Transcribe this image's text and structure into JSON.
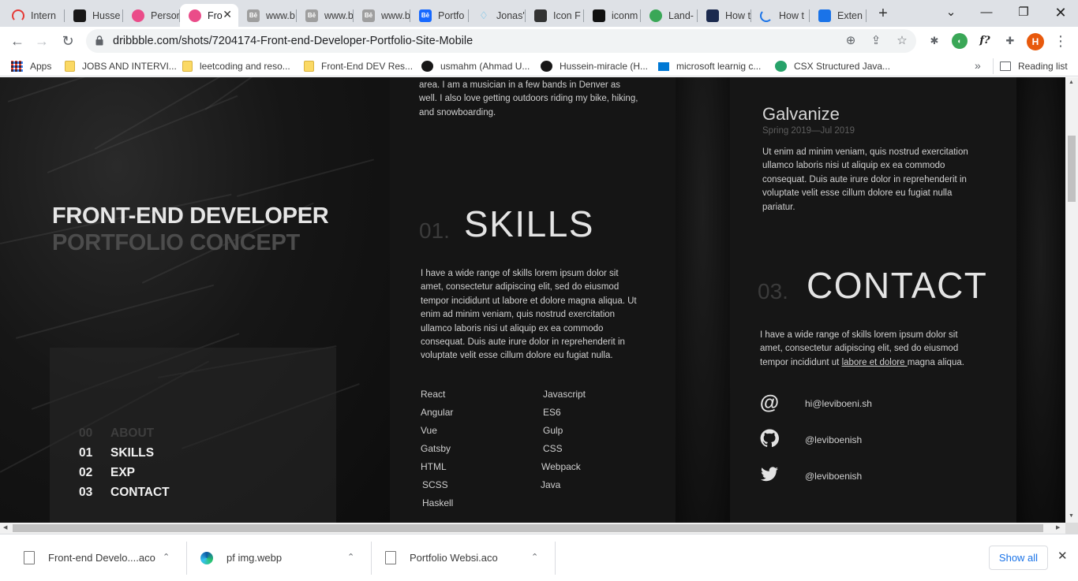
{
  "tabs": [
    {
      "label": "Intern",
      "icon": "rainbow-icon",
      "color": "#e53935"
    },
    {
      "label": "Husse",
      "icon": "github-icon",
      "color": "#181717"
    },
    {
      "label": "Persor",
      "icon": "dribbble-icon",
      "color": "#ea4c89"
    },
    {
      "label": "Fro",
      "icon": "dribbble-icon",
      "color": "#ea4c89",
      "active": true
    },
    {
      "label": "www.b",
      "icon": "behance-icon",
      "color": "#9e9e9e"
    },
    {
      "label": "www.b",
      "icon": "behance-icon",
      "color": "#9e9e9e"
    },
    {
      "label": "www.b",
      "icon": "behance-icon",
      "color": "#9e9e9e"
    },
    {
      "label": "Portfo",
      "icon": "behance-icon",
      "color": "#1769ff"
    },
    {
      "label": "Jonas'",
      "icon": "diamond-icon",
      "color": "#4fb7e8"
    },
    {
      "label": "Icon F",
      "icon": "icon-font-icon",
      "color": "#333333"
    },
    {
      "label": "iconm",
      "icon": "iconmonstr-icon",
      "color": "#111111"
    },
    {
      "label": "Land-",
      "icon": "globe-icon",
      "color": "#3aa757"
    },
    {
      "label": "How t",
      "icon": "anthropic-icon",
      "color": "#1b2a4e"
    },
    {
      "label": "How t",
      "icon": "loading-icon",
      "color": "#1a73e8"
    },
    {
      "label": "Exten",
      "icon": "puzzle-icon",
      "color": "#1a73e8"
    }
  ],
  "browser": {
    "url": "dribbble.com/shots/7204174-Front-end-Developer-Portfolio-Site-Mobile",
    "profile_initial": "H",
    "ext_fx": "f?"
  },
  "bookmarks": [
    {
      "label": "Apps",
      "icon": "apps-grid-icon"
    },
    {
      "label": "JOBS AND INTERVI...",
      "icon": "folder-icon"
    },
    {
      "label": "leetcoding and reso...",
      "icon": "folder-icon"
    },
    {
      "label": "Front-End DEV Res...",
      "icon": "folder-icon"
    },
    {
      "label": "usmahm (Ahmad U...",
      "icon": "github-icon"
    },
    {
      "label": "Hussein-miracle (H...",
      "icon": "github-icon"
    },
    {
      "label": "microsoft learnig c...",
      "icon": "microsoft-icon"
    },
    {
      "label": "CSX Structured Java...",
      "icon": "csx-icon"
    }
  ],
  "bookmarks_more": "»",
  "reading_list": "Reading list",
  "page": {
    "hero_title": "FRONT-END DEVELOPER",
    "hero_subtitle": "PORTFOLIO CONCEPT",
    "nav": [
      {
        "num": "00",
        "label": "ABOUT",
        "active": false
      },
      {
        "num": "01",
        "label": "SKILLS",
        "active": true
      },
      {
        "num": "02",
        "label": "EXP",
        "active": true
      },
      {
        "num": "03",
        "label": "CONTACT",
        "active": true
      }
    ],
    "about_tail": "area. I am a musician in a few bands in Denver as well. I also love getting outdoors riding my bike, hiking, and snowboarding.",
    "skills_num": "01.",
    "skills_title": "SKILLS",
    "skills_text": "I have a wide range of skills  lorem ipsum dolor sit amet, consectetur adipiscing elit, sed do eiusmod tempor incididunt ut labore et dolore magna aliqua. Ut enim ad minim veniam, quis nostrud exercitation ullamco laboris nisi ut aliquip ex ea commodo consequat. Duis aute irure dolor in reprehenderit in voluptate velit esse cillum dolore eu fugiat nulla.",
    "skills_left": [
      "React",
      "Angular",
      "Vue",
      "Gatsby",
      "HTML",
      "SCSS",
      "Haskell"
    ],
    "skills_right": [
      "Javascript",
      "ES6",
      "Gulp",
      "CSS",
      "Webpack",
      "Java"
    ],
    "exp_company": "Galvanize",
    "exp_dates": "Spring 2019—Jul 2019",
    "exp_text": "Ut enim ad minim veniam, quis nostrud exercitation ullamco laboris nisi ut aliquip ex ea commodo consequat. Duis aute irure dolor in reprehenderit in voluptate velit esse cillum dolore eu fugiat nulla pariatur.",
    "contact_num": "03.",
    "contact_title": "CONTACT",
    "contact_text_a": "I have a wide range of skills  lorem ipsum dolor sit amet, consectetur adipiscing elit, sed do eiusmod tempor incididunt ut ",
    "contact_link": "labore et dolore ",
    "contact_text_b": "magna aliqua.",
    "contacts": [
      {
        "icon": "at-sign-icon",
        "glyph": "@",
        "value": "hi@leviboeni.sh"
      },
      {
        "icon": "github-icon",
        "glyph": "",
        "value": "@leviboenish"
      },
      {
        "icon": "twitter-icon",
        "glyph": "",
        "value": "@leviboenish"
      }
    ]
  },
  "downloads": [
    {
      "name": "Front-end Develo....aco",
      "icon": "file-icon"
    },
    {
      "name": "pf img.webp",
      "icon": "edge-icon"
    },
    {
      "name": "Portfolio Websi.aco",
      "icon": "file-icon"
    }
  ],
  "show_all": "Show all"
}
